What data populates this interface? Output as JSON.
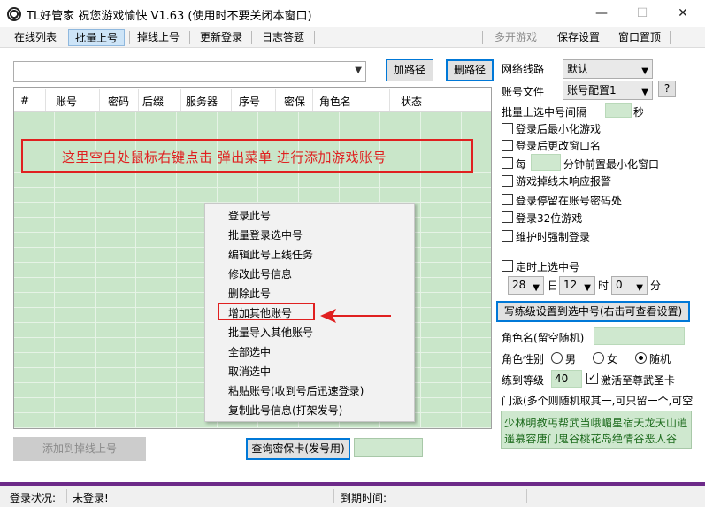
{
  "window": {
    "title": "TL好管家 祝您游戏愉快 V1.63  (使用时不要关闭本窗口)",
    "minimize": "—",
    "maximize": "☐",
    "close": "✕"
  },
  "toolbar": {
    "items": [
      "在线列表",
      "批量上号",
      "掉线上号",
      "更新登录",
      "日志答题"
    ],
    "active": "批量上号",
    "right_items": [
      "多开游戏",
      "保存设置",
      "窗口置顶"
    ]
  },
  "path": {
    "value": "",
    "add_label": "加路径",
    "delete_label": "删路径"
  },
  "grid": {
    "columns": [
      "#",
      "账号",
      "密码",
      "后缀",
      "服务器",
      "序号",
      "密保",
      "角色名",
      "状态"
    ],
    "hint": "这里空白处鼠标右键点击  弹出菜单  进行添加游戏账号"
  },
  "context_menu": {
    "items": [
      "登录此号",
      "批量登录选中号",
      "编辑此号上线任务",
      "修改此号信息",
      "删除此号",
      "增加其他账号",
      "批量导入其他账号",
      "全部选中",
      "取消选中",
      "粘贴账号(收到号后迅速登录)",
      "复制此号信息(打架发号)"
    ],
    "highlighted": "增加其他账号"
  },
  "bottom_buttons": {
    "add_to_dropped": "添加到掉线上号",
    "query_card": "查询密保卡(发号用)",
    "query_value": ""
  },
  "settings": {
    "network_label": "网络线路",
    "network_value": "默认",
    "account_file_label": "账号文件",
    "account_file_value": "账号配置1",
    "help": "?",
    "interval_label": "批量上选中号间隔",
    "interval_value": "",
    "interval_unit": "秒",
    "checks": [
      {
        "label": "登录后最小化游戏",
        "checked": false
      },
      {
        "label": "登录后更改窗口名",
        "checked": false
      },
      {
        "label": "游戏掉线未响应报警",
        "checked": false
      },
      {
        "label": "登录停留在账号密码处",
        "checked": false
      },
      {
        "label": "登录32位游戏",
        "checked": false
      },
      {
        "label": "维护时强制登录",
        "checked": false
      }
    ],
    "minimize_before": {
      "prefix": "每",
      "value": "",
      "suffix": "分钟前置最小化窗口",
      "checked": false
    },
    "timer": {
      "label": "定时上选中号",
      "checked": false,
      "day": "28",
      "day_unit": "日",
      "hour": "12",
      "hour_unit": "时",
      "minute": "0",
      "minute_unit": "分"
    },
    "write_level_btn": "写练级设置到选中号(右击可查看设置)",
    "role_name_label": "角色名(留空随机)",
    "role_name_value": "",
    "gender_label": "角色性别",
    "gender_options": [
      "男",
      "女",
      "随机"
    ],
    "gender_selected": "随机",
    "level_label": "练到等级",
    "level_value": "40",
    "activate_label": "激活至尊武圣卡",
    "activate_checked": true,
    "sect_hint": "门派(多个则随机取其一,可只留一个,可空",
    "sects_line1": "少林明教丐帮武当峨嵋星宿天龙天山逍",
    "sects_line2": "遥慕容唐门鬼谷桃花岛绝情谷恶人谷"
  },
  "status": {
    "login_label": "登录状况:",
    "login_value": "未登录!",
    "expire_label": "到期时间:",
    "expire_value": ""
  },
  "colors": {
    "grid_green": "#c9e6c9",
    "hint_red": "#e02020",
    "accent_blue": "#0078d7",
    "bottom_strip": "#6d2a89"
  }
}
